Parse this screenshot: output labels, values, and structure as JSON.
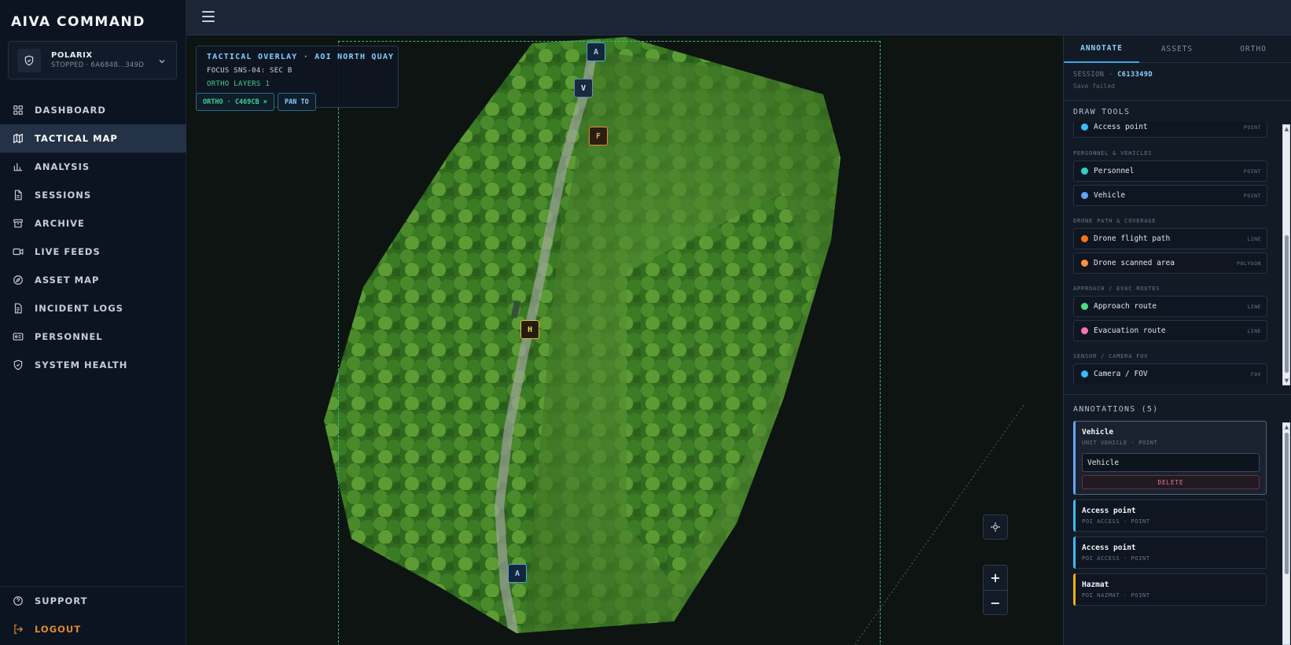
{
  "app": {
    "title": "AIVA COMMAND"
  },
  "project": {
    "name": "POLARIX",
    "status": "STOPPED · 6A6848...349D"
  },
  "nav": [
    {
      "label": "DASHBOARD",
      "icon": "grid-icon"
    },
    {
      "label": "TACTICAL MAP",
      "icon": "map-icon",
      "active": true
    },
    {
      "label": "ANALYSIS",
      "icon": "bar-chart-icon"
    },
    {
      "label": "SESSIONS",
      "icon": "document-icon"
    },
    {
      "label": "ARCHIVE",
      "icon": "archive-icon"
    },
    {
      "label": "LIVE FEEDS",
      "icon": "video-icon"
    },
    {
      "label": "ASSET MAP",
      "icon": "compass-icon"
    },
    {
      "label": "INCIDENT LOGS",
      "icon": "log-icon"
    },
    {
      "label": "PERSONNEL",
      "icon": "id-card-icon"
    },
    {
      "label": "SYSTEM HEALTH",
      "icon": "shield-icon"
    }
  ],
  "footer_nav": {
    "support": "SUPPORT",
    "logout": "LOGOUT"
  },
  "overlay": {
    "title": "TACTICAL OVERLAY · AOI NORTH QUAY",
    "focus": "FOCUS SNS-04: SEC B",
    "layers": "ORTHO LAYERS 1",
    "ortho_chip": "ORTHO · C469CB ×",
    "pan_button": "PAN TO"
  },
  "markers": [
    {
      "label": "A",
      "kind": "access"
    },
    {
      "label": "V",
      "kind": "vehicle"
    },
    {
      "label": "F",
      "kind": "fire"
    },
    {
      "label": "H",
      "kind": "hazmat"
    },
    {
      "label": "A",
      "kind": "access"
    }
  ],
  "tabs": [
    "ANNOTATE",
    "ASSETS",
    "ORTHO"
  ],
  "session": {
    "label": "SESSION ·",
    "id": "C613349D",
    "save_status": "Save failed"
  },
  "draw_tools": {
    "title": "DRAW TOOLS",
    "groups": [
      {
        "label": "",
        "tools": [
          {
            "name": "Access point",
            "type": "POINT",
            "color": "#38bdf8"
          }
        ]
      },
      {
        "label": "PERSONNEL & VEHICLES",
        "tools": [
          {
            "name": "Personnel",
            "type": "POINT",
            "color": "#2dd4bf"
          },
          {
            "name": "Vehicle",
            "type": "POINT",
            "color": "#60a5fa"
          }
        ]
      },
      {
        "label": "DRONE PATH & COVERAGE",
        "tools": [
          {
            "name": "Drone flight path",
            "type": "LINE",
            "color": "#f97316"
          },
          {
            "name": "Drone scanned area",
            "type": "POLYGON",
            "color": "#fb923c"
          }
        ]
      },
      {
        "label": "APPROACH / EVAC ROUTES",
        "tools": [
          {
            "name": "Approach route",
            "type": "LINE",
            "color": "#4ade80"
          },
          {
            "name": "Evacuation route",
            "type": "LINE",
            "color": "#f472b6"
          }
        ]
      },
      {
        "label": "SENSOR / CAMERA FOV",
        "tools": [
          {
            "name": "Camera / FOV",
            "type": "FOV",
            "color": "#38bdf8"
          }
        ]
      }
    ]
  },
  "annotations": {
    "title": "ANNOTATIONS (5)",
    "items": [
      {
        "title": "Vehicle",
        "sub": "UNIT VEHICLE · POINT",
        "color": "#60a5fa",
        "selected": true,
        "input_value": "Vehicle",
        "delete_label": "DELETE"
      },
      {
        "title": "Access point",
        "sub": "POI ACCESS · POINT",
        "color": "#38bdf8"
      },
      {
        "title": "Access point",
        "sub": "POI ACCESS · POINT",
        "color": "#38bdf8"
      },
      {
        "title": "Hazmat",
        "sub": "POI HAZMAT · POINT",
        "color": "#eab308"
      }
    ]
  },
  "map_controls": {
    "locate": "locate-icon",
    "zoom_in": "+",
    "zoom_out": "−"
  }
}
